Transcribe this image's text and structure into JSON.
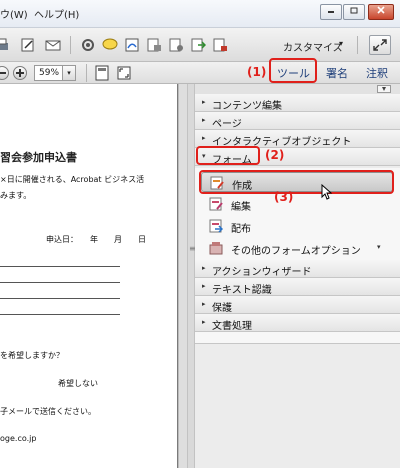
{
  "menubar": {
    "items": [
      "ウ(W)",
      "ヘルプ(H)"
    ],
    "window_buttons": [
      "minimize",
      "restore",
      "close"
    ]
  },
  "toolbar1": {
    "icons": [
      "print-icon",
      "edit-icon",
      "mail-icon",
      "gear-icon",
      "comment-icon",
      "sign-icon",
      "lock-pdf-icon",
      "lock-pdf-2-icon",
      "export-pdf-icon",
      "document-icon"
    ],
    "customize_label": "カスタマイズ",
    "customize_arrow": "▾"
  },
  "toolbar2": {
    "zoom_value": "59%",
    "zoom_arrow": "▾",
    "tabs": {
      "tools": "ツール",
      "sign": "署名",
      "comment": "注釈"
    }
  },
  "annotations": {
    "step1": "(1)",
    "step2": "(2)",
    "step3": "(3)"
  },
  "document": {
    "title": "習会参加申込書",
    "lines": [
      "×日に開催される、Acrobat ビジネス活",
      "みます。",
      "申込日：　　年　　月　　日",
      "を希望しますか？",
      "希望しない",
      "子メールで送信ください。",
      "oge.co.jp"
    ]
  },
  "panel": {
    "sections_top": [
      {
        "label": "コンテンツ編集",
        "expanded": false
      },
      {
        "label": "ページ",
        "expanded": false
      },
      {
        "label": "インタラクティブオブジェクト",
        "expanded": false
      }
    ],
    "form_section": {
      "label": "フォーム",
      "expanded": true
    },
    "form_items": [
      {
        "label": "作成",
        "icon": "create-form-icon",
        "active": true
      },
      {
        "label": "編集",
        "icon": "edit-form-icon",
        "active": false
      },
      {
        "label": "配布",
        "icon": "distribute-form-icon",
        "active": false
      },
      {
        "label": "その他のフォームオプション",
        "icon": "more-form-options-icon",
        "active": false,
        "has_dropdown": true
      }
    ],
    "sections_bottom": [
      {
        "label": "アクションウィザード",
        "expanded": false
      },
      {
        "label": "テキスト認識",
        "expanded": false
      },
      {
        "label": "保護",
        "expanded": false
      },
      {
        "label": "文書処理",
        "expanded": false
      }
    ],
    "collapsed_glyph": "▸",
    "expanded_glyph": "▾",
    "dropdown_glyph": "▾"
  }
}
